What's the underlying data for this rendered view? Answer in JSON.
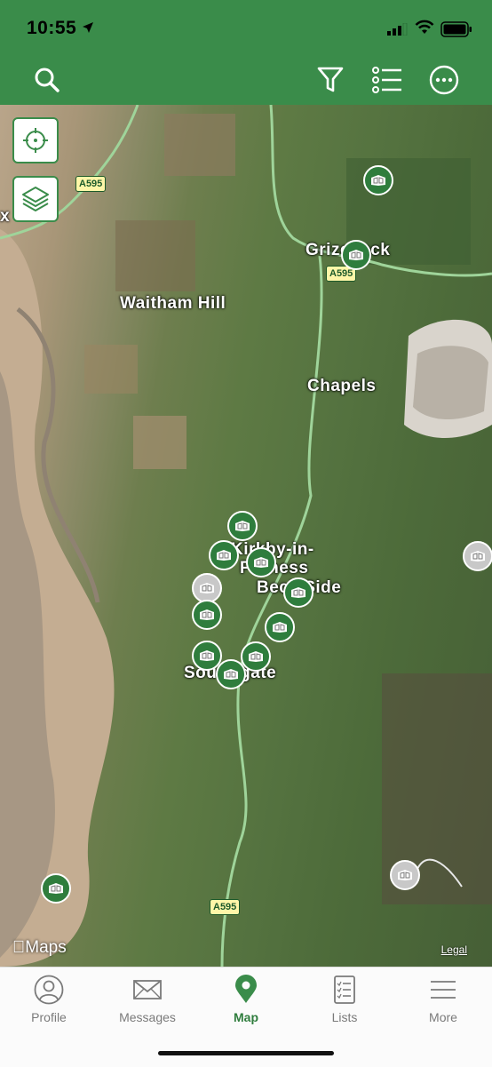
{
  "status_bar": {
    "time": "10:55"
  },
  "toolbar": {
    "search_icon": "search-icon",
    "filter_icon": "filter-icon",
    "list_icon": "list-icon",
    "more_icon": "ellipsis-circle-icon"
  },
  "map": {
    "places": [
      "Waitham Hill",
      "Grizebeck",
      "Chapels",
      "Kirkby-in-",
      "Furness",
      "Beck Side",
      "Soutergate"
    ],
    "roads": [
      "A595",
      "A595",
      "A595"
    ],
    "attribution": "Maps",
    "legal": "Legal",
    "edge_label": "x"
  },
  "tabs": [
    {
      "label": "Profile",
      "icon": "person-icon"
    },
    {
      "label": "Messages",
      "icon": "envelope-icon"
    },
    {
      "label": "Map",
      "icon": "map-pin-icon",
      "active": true
    },
    {
      "label": "Lists",
      "icon": "checklist-icon"
    },
    {
      "label": "More",
      "icon": "menu-icon"
    }
  ],
  "colors": {
    "brand": "#3a8c4a",
    "pin_active": "#2f7d3d",
    "pin_inactive": "#c8c8c8"
  }
}
